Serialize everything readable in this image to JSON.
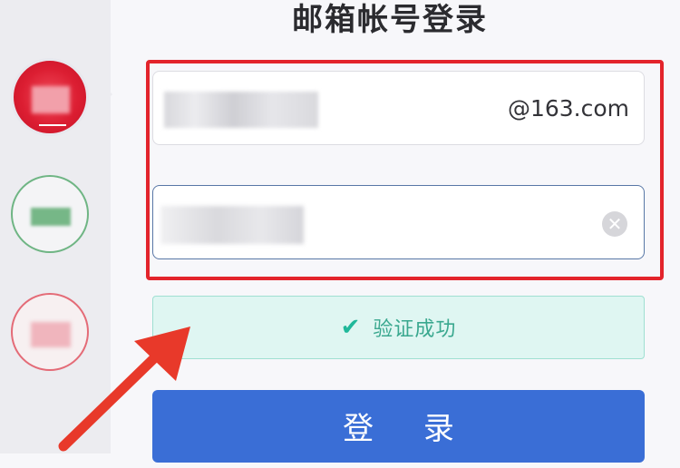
{
  "page": {
    "title": "邮箱帐号登录"
  },
  "form": {
    "email": {
      "value": "",
      "domain": "@163.com"
    },
    "password": {
      "value": "",
      "clear_icon": "close-icon"
    },
    "verify": {
      "text": "验证成功",
      "icon": "checkmark-icon"
    },
    "login_label": "登 录"
  },
  "annotation": {
    "highlight_color": "#e3242b",
    "arrow_color": "#e8392a"
  },
  "colors": {
    "primary": "#3a6ed6",
    "success": "#1fb89a"
  }
}
